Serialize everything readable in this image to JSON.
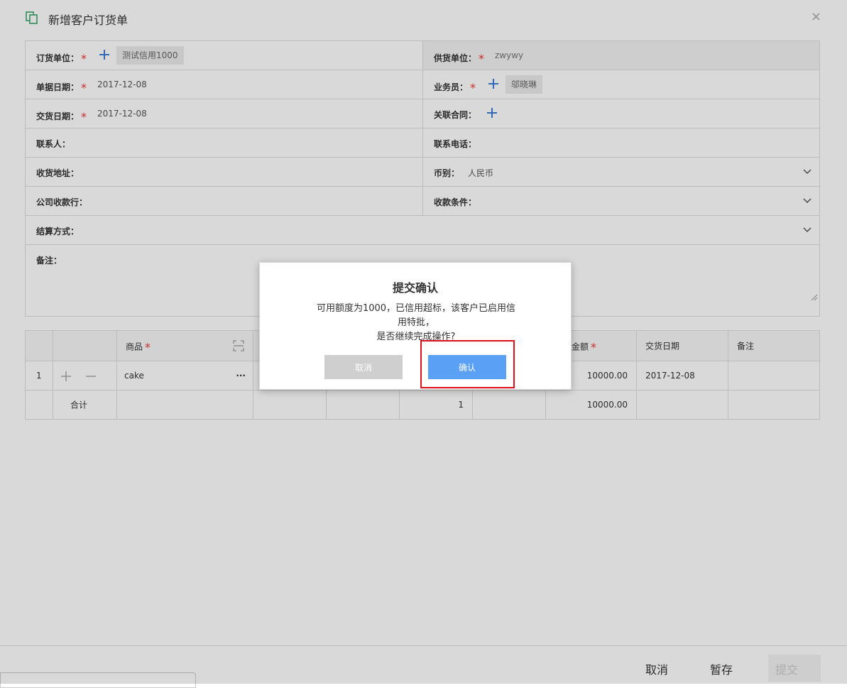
{
  "header": {
    "title": "新增客户订货单",
    "close_glyph": "×"
  },
  "form": {
    "order_unit": {
      "label": "订货单位：",
      "required": "*",
      "value": "测试信用1000"
    },
    "supplier": {
      "label": "供货单位：",
      "required": "*",
      "value": "zwywy"
    },
    "doc_date": {
      "label": "单据日期：",
      "required": "*",
      "value": "2017-12-08"
    },
    "salesman": {
      "label": "业务员：",
      "required": "*",
      "value": "邬晓琳"
    },
    "delivery_date": {
      "label": "交货日期：",
      "required": "*",
      "value": "2017-12-08"
    },
    "contract": {
      "label": "关联合同："
    },
    "contact": {
      "label": "联系人："
    },
    "phone": {
      "label": "联系电话："
    },
    "address": {
      "label": "收货地址："
    },
    "currency": {
      "label": "币别：",
      "value": "人民币"
    },
    "bank": {
      "label": "公司收款行："
    },
    "terms": {
      "label": "收款条件："
    },
    "settlement": {
      "label": "结算方式："
    },
    "remark": {
      "label": "备注："
    }
  },
  "grid": {
    "headers": {
      "product": "商品",
      "amount": "金额",
      "delivery_date": "交货日期",
      "remark": "备注",
      "required": "*"
    },
    "rows": [
      {
        "index": "1",
        "product": "cake",
        "amount": "10000.00",
        "delivery_date": "2017-12-08"
      }
    ],
    "total": {
      "label": "合计",
      "qty": "1",
      "amount": "10000.00"
    }
  },
  "footer": {
    "cancel": "取消",
    "save": "暂存",
    "submit": "提交"
  },
  "dialog": {
    "title": "提交确认",
    "message_line1": "可用额度为1000，已信用超标，该客户已启用信",
    "message_line2": "用特批，",
    "message_line3": "是否继续完成操作?",
    "cancel": "取消",
    "confirm": "确认"
  },
  "colors": {
    "accent": "#5aa0f5",
    "required": "#e33333",
    "highlight": "#e0101a",
    "icon_green": "#3aa76d"
  }
}
